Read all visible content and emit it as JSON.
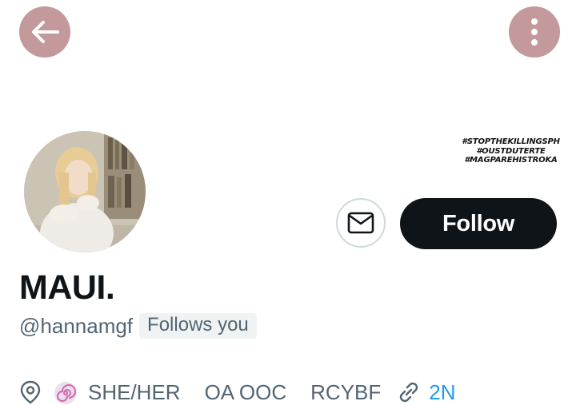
{
  "header": {
    "back_icon": "arrow-left-icon",
    "more_icon": "more-vertical-icon",
    "button_color": "#c4999b"
  },
  "banner": {
    "lines": [
      "#STOPTHEKILLINGSPH",
      "#OUSTDUTERTE",
      "#MAGPAREHISTROKA"
    ]
  },
  "profile": {
    "display_name": "MAUI.",
    "handle": "@hannamgf",
    "follows_badge": "Follows you"
  },
  "actions": {
    "message_icon": "mail-icon",
    "follow_label": "Follow"
  },
  "info": {
    "location_icon": "location-pin-icon",
    "location_emoji_icon": "spiral-shell-icon",
    "location_parts": [
      "SHE/HER",
      "OA OOC",
      "RCYBF"
    ],
    "link_icon": "link-icon",
    "link_text": "2N"
  },
  "colors": {
    "text_primary": "#0f1419",
    "text_secondary": "#536471",
    "follow_bg": "#0f1419",
    "link": "#1d9bf0"
  }
}
